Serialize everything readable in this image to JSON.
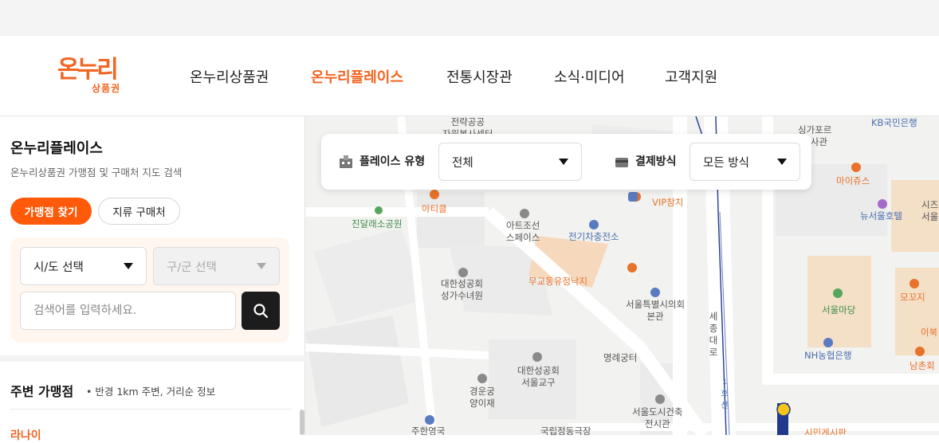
{
  "brand": {
    "logo_main": "온누리",
    "logo_sub": "상품권",
    "accent": "#f26522"
  },
  "nav": {
    "items": [
      {
        "label": "온누리상품권"
      },
      {
        "label": "온누리플레이스"
      },
      {
        "label": "전통시장관"
      },
      {
        "label": "소식·미디어"
      },
      {
        "label": "고객지원"
      }
    ],
    "active_index": 1
  },
  "sidebar": {
    "title": "온누리플레이스",
    "subtitle": "온누리상품권 가맹점 및 구매처 지도 검색",
    "tabs": [
      {
        "label": "가맹점 찾기"
      },
      {
        "label": "지류 구매처"
      }
    ],
    "province_select": {
      "value": "시/도 선택"
    },
    "district_select": {
      "value": "구/군 선택"
    },
    "search": {
      "placeholder": "검색어를 입력하세요."
    },
    "nearby": {
      "title": "주변 가맹점",
      "subtitle": "• 반경 1km 주변, 거리순 정보",
      "first_item": "라나이"
    }
  },
  "filter": {
    "place_type": {
      "label": "플레이스 유형",
      "value": "전체",
      "icon": "building-icon"
    },
    "payment": {
      "label": "결제방식",
      "value": "모든 방식",
      "icon": "card-icon"
    }
  },
  "map": {
    "labels": [
      "전략공공\n자원봉사센터",
      "아티클",
      "진달래소공원",
      "아트조선\n스페이스",
      "전기차충전소",
      "VIP참치",
      "대한성공회\n성가수녀원",
      "무교동유정낙지",
      "서울특별시의회\n본관",
      "명례궁터",
      "대한성공회\n서울교구",
      "경운궁\n양이재",
      "서울도시건축\n전시관",
      "주한영국",
      "국립정동극장",
      "싱가포르\n대사관",
      "KB국민은행",
      "마이쥬스",
      "뉴서울호텔",
      "서울마당",
      "NH농협은행",
      "모꼬지",
      "이북",
      "남촌회",
      "시즈\n서울",
      "세종대로",
      "1호선",
      "시민게시판"
    ]
  }
}
